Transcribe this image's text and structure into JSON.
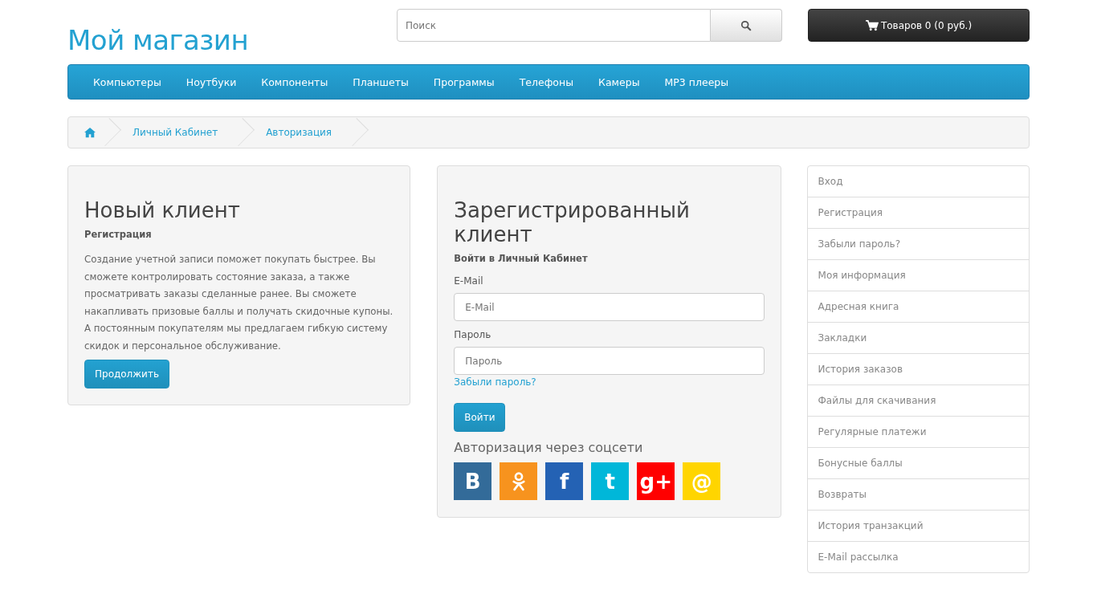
{
  "header": {
    "logo": "Мой магазин",
    "search": {
      "placeholder": "Поиск"
    },
    "cart": "Товаров 0 (0 руб.)"
  },
  "nav": [
    "Компьютеры",
    "Ноутбуки",
    "Компоненты",
    "Планшеты",
    "Программы",
    "Телефоны",
    "Камеры",
    "MP3 плееры"
  ],
  "breadcrumb": [
    "Личный Кабинет",
    "Авторизация"
  ],
  "new_customer": {
    "title": "Новый клиент",
    "subtitle": "Регистрация",
    "text": "Создание учетной записи поможет покупать быстрее. Вы сможете контролировать состояние заказа, а также просматривать заказы сделанные ранее. Вы сможете накапливать призовые баллы и получать скидочные купоны. А постоянным покупателям мы предлагаем гибкую систему скидок и персональное обслуживание.",
    "button": "Продолжить"
  },
  "returning_customer": {
    "title": "Зарегистрированный клиент",
    "subtitle": "Войти в Личный Кабинет",
    "fields": [
      {
        "label": "E-Mail",
        "placeholder": "E-Mail"
      },
      {
        "label": "Пароль",
        "placeholder": "Пароль"
      }
    ],
    "forgot_link": "Забыли пароль?",
    "button": "Войти",
    "social_title": "Авторизация через соцсети",
    "social": [
      {
        "kind": "glyph",
        "glyph": "B",
        "color": "#336b99"
      },
      {
        "kind": "ok",
        "color": "#f7931e"
      },
      {
        "kind": "glyph",
        "glyph": "f",
        "color": "#2462b4"
      },
      {
        "kind": "glyph",
        "glyph": "t",
        "color": "#00b7d9"
      },
      {
        "kind": "glyph",
        "glyph": "g+",
        "color": "#ff0000"
      },
      {
        "kind": "glyph",
        "glyph": "@",
        "color": "#ffd500"
      }
    ]
  },
  "sidebar": {
    "items": [
      "Вход",
      "Регистрация",
      "Забыли пароль?",
      "Моя информация",
      "Адресная книга",
      "Закладки",
      "История заказов",
      "Файлы для скачивания",
      "Регулярные платежи",
      "Бонусные баллы",
      "Возвраты",
      "История транзакций",
      "E-Mail рассылка"
    ]
  }
}
